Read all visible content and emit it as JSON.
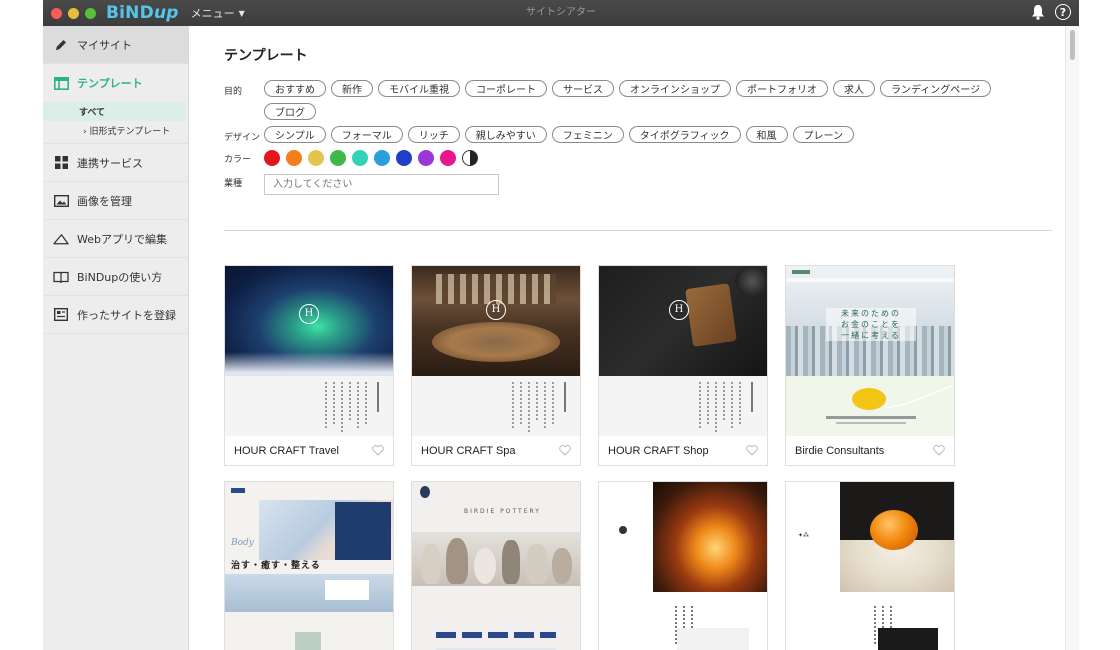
{
  "titlebar": {
    "brand": "BiNDup",
    "menu_label": "メニュー",
    "window_title": "サイトシアター"
  },
  "sidebar": {
    "items": [
      {
        "label": "マイサイト",
        "icon": "pencil-icon"
      },
      {
        "label": "テンプレート",
        "icon": "template-icon"
      },
      {
        "label": "連携サービス",
        "icon": "grid-icon"
      },
      {
        "label": "画像を管理",
        "icon": "image-icon"
      },
      {
        "label": "Webアプリで編集",
        "icon": "cloud-icon"
      },
      {
        "label": "BiNDupの使い方",
        "icon": "book-icon"
      },
      {
        "label": "作ったサイトを登録",
        "icon": "register-icon"
      }
    ],
    "sub_items": [
      {
        "label": "すべて"
      },
      {
        "label": "› 旧形式テンプレート"
      }
    ]
  },
  "main": {
    "title": "テンプレート",
    "filters": {
      "purpose_label": "目的",
      "purpose": [
        "おすすめ",
        "新作",
        "モバイル重視",
        "コーポレート",
        "サービス",
        "オンラインショップ",
        "ポートフォリオ",
        "求人",
        "ランディングページ",
        "ブログ"
      ],
      "design_label": "デザイン",
      "design": [
        "シンプル",
        "フォーマル",
        "リッチ",
        "親しみやすい",
        "フェミニン",
        "タイポグラフィック",
        "和風",
        "プレーン"
      ],
      "color_label": "カラー",
      "colors": [
        "#e5161b",
        "#f57e18",
        "#e3c44f",
        "#3db84a",
        "#33d1b5",
        "#2a9fdc",
        "#1f3fc8",
        "#9b36d8",
        "#e8178d",
        "bw"
      ],
      "industry_label": "業種",
      "industry_placeholder": "入力してください"
    },
    "cards": [
      {
        "name": "HOUR CRAFT Travel"
      },
      {
        "name": "HOUR CRAFT Spa"
      },
      {
        "name": "HOUR CRAFT Shop"
      },
      {
        "name": "Birdie Consultants"
      },
      {
        "name": ""
      },
      {
        "name": ""
      },
      {
        "name": ""
      },
      {
        "name": ""
      }
    ],
    "thumb_text": {
      "birdie_headline": "未来のための\nお金のことを\n一緒に考える",
      "spa2_headline": "治す・癒す・整える",
      "pottery_headline": "BIRDIE POTTERY"
    }
  }
}
